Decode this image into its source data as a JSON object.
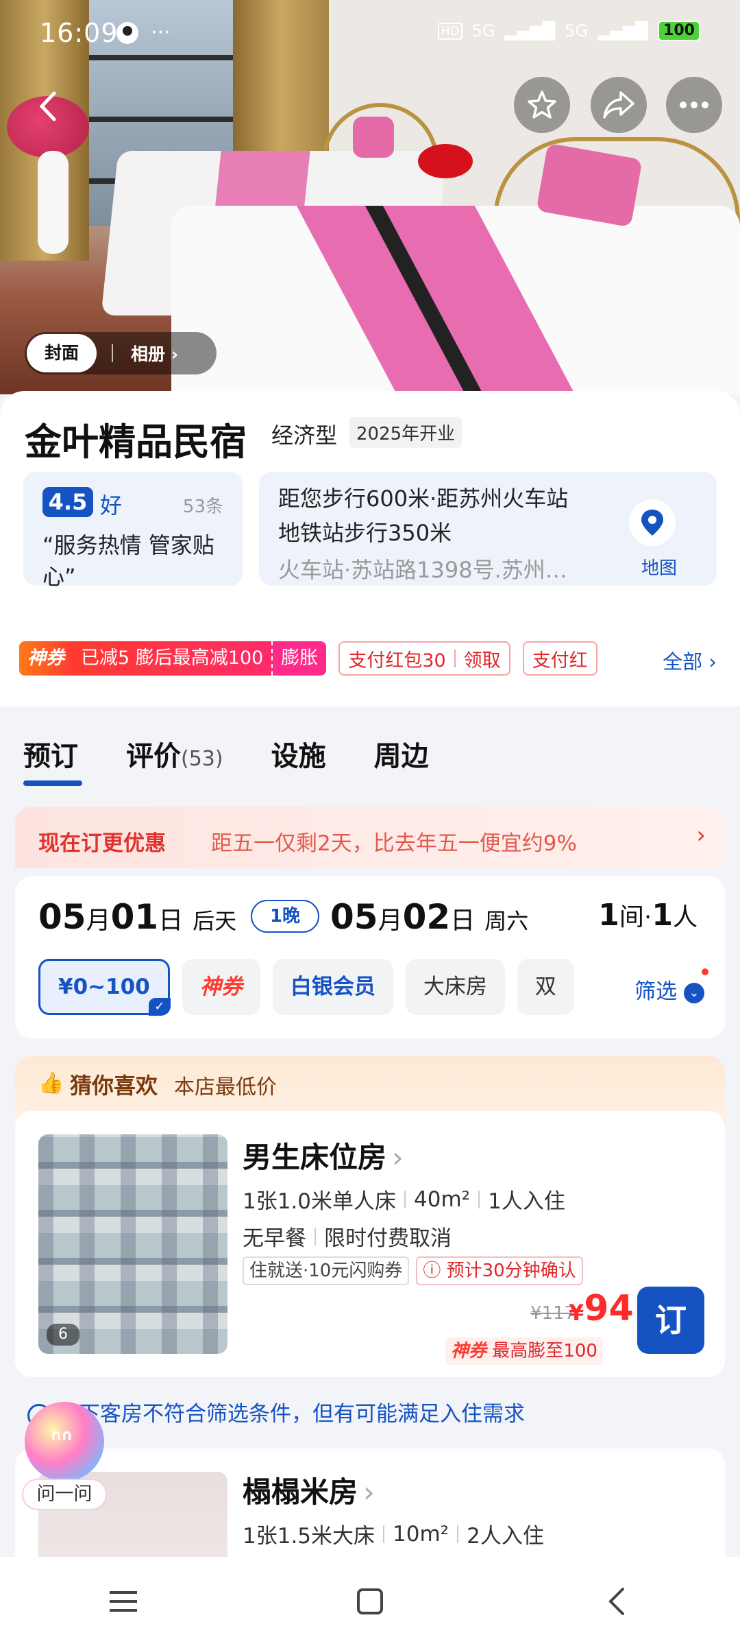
{
  "status_bar": {
    "time": "16:09",
    "battery": "100",
    "net1": "5G",
    "net2": "5G",
    "hd": "HD"
  },
  "photo_tabs": {
    "cover": "封面",
    "album": "相册 ›"
  },
  "hotel": {
    "name": "金叶精品民宿",
    "type": "经济型",
    "opened": "2025年开业"
  },
  "rating": {
    "score": "4.5",
    "label": "好",
    "count": "53条",
    "quote": "“服务热情 管家贴心”"
  },
  "location": {
    "line1": "距您步行600米·距苏州火车站",
    "line2": "地铁站步行350米",
    "address": "火车站·苏站路1398号.苏州…",
    "map_label": "地图"
  },
  "promos": {
    "shenquan_brand": "神券",
    "shenquan_text": "已减5 膨后最高减100",
    "shenquan_action": "膨胀",
    "coupon1_text": "支付红包30",
    "coupon1_action": "领取",
    "coupon2_text": "支付红",
    "all_label": "全部 ›"
  },
  "tabs": [
    {
      "label": "预订"
    },
    {
      "label": "评价",
      "sub": "(53)"
    },
    {
      "label": "设施"
    },
    {
      "label": "周边"
    }
  ],
  "offer": {
    "title": "现在订更优惠",
    "text": "距五一仅剩2天，比去年五一便宜约9%",
    "chevron": "›"
  },
  "dates": {
    "checkin_month": "05",
    "checkin_m_label": "月",
    "checkin_day": "01",
    "checkin_d_label": "日",
    "checkin_week": "后天",
    "nights": "1晚",
    "checkout_month": "05",
    "checkout_m_label": "月",
    "checkout_day": "02",
    "checkout_d_label": "日",
    "checkout_week": "周六",
    "rooms_num": "1",
    "rooms_label": "间",
    "sep": "·",
    "people_num": "1",
    "people_label": "人"
  },
  "filters": {
    "chips": [
      "¥0~100",
      "神券",
      "白银会员",
      "大床房",
      "双"
    ],
    "filter_label": "筛选"
  },
  "recommend": {
    "title": "猜你喜欢",
    "subtitle": "本店最低价"
  },
  "room1": {
    "name": "男生床位房",
    "photo_count": "6",
    "bed": "1张1.0米单人床",
    "area": "40m²",
    "occupancy": "1人入住",
    "meal": "无早餐",
    "cancel": "限时付费取消",
    "pill1": "住就送·10元闪购券",
    "pill2": "ⓘ 预计30分钟确认",
    "price_old": "¥117",
    "price_symbol": "¥",
    "price_new": "94",
    "promo_brand": "神券",
    "promo_text": "最高膨至100",
    "book_label": "订"
  },
  "notice": "以下客房不符合筛选条件，但有可能满足入住需求",
  "room2": {
    "name": "榻榻米房",
    "bed": "1张1.5米大床",
    "area": "10m²",
    "occupancy": "2人入住"
  },
  "assistant": {
    "label": "问一问"
  }
}
